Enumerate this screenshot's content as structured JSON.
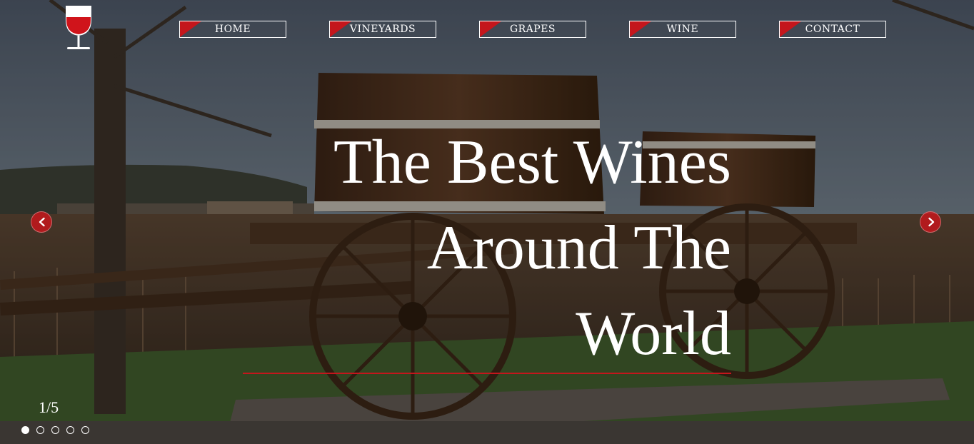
{
  "nav": {
    "items": [
      {
        "label": "HOME"
      },
      {
        "label": "VINEYARDS"
      },
      {
        "label": "GRAPES"
      },
      {
        "label": "WINE"
      },
      {
        "label": "CONTACT"
      }
    ]
  },
  "hero": {
    "headline_line1": "The Best Wines",
    "headline_line2": "Around The",
    "headline_line3": "World"
  },
  "slider": {
    "counter": "1/5",
    "total_slides": 5,
    "active_slide": 1
  },
  "icons": {
    "logo": "wine-glass-icon",
    "prev": "chevron-left-icon",
    "next": "chevron-right-icon"
  },
  "colors": {
    "accent": "#c4161c",
    "text": "#ffffff"
  }
}
